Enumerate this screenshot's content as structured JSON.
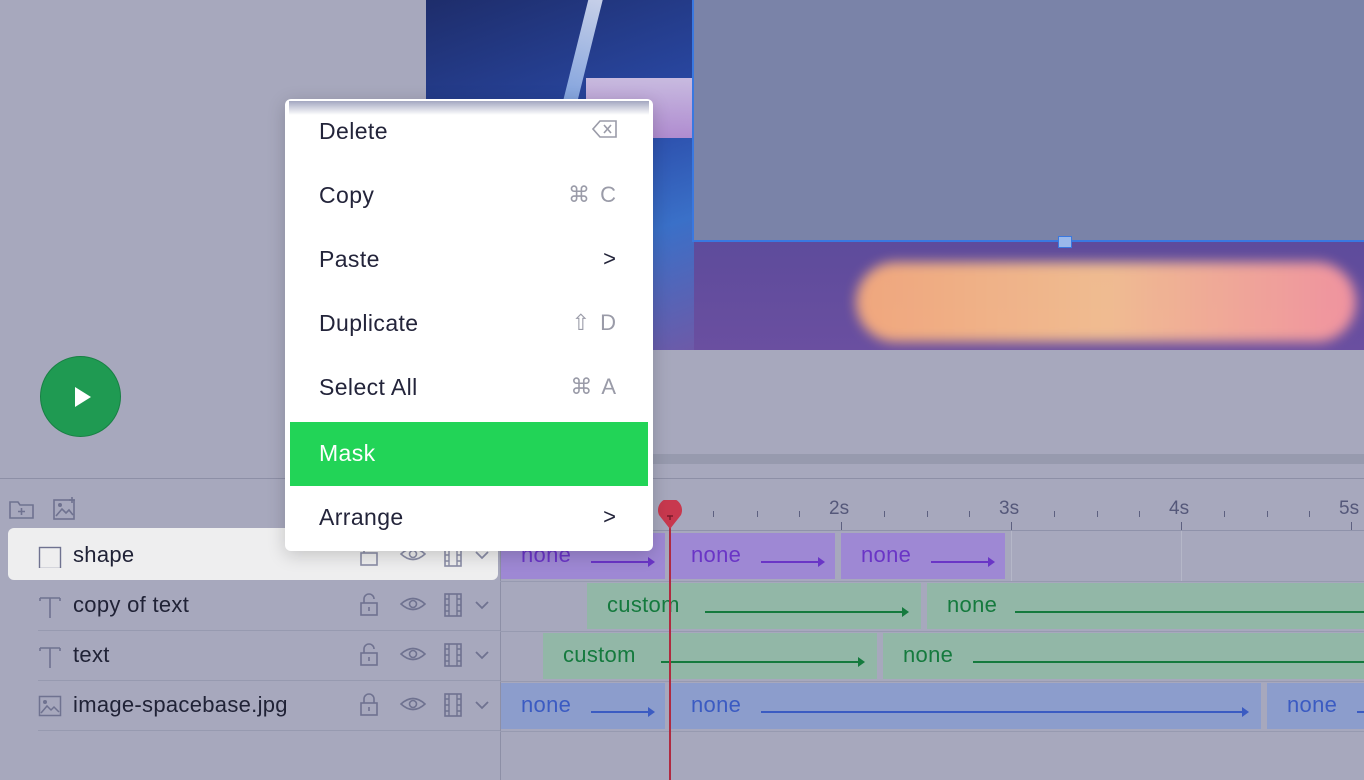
{
  "playback": {
    "play_icon": "play-icon"
  },
  "context_menu": {
    "items": [
      {
        "label": "Delete",
        "shortcut": "⌫"
      },
      {
        "label": "Copy",
        "shortcut": "⌘ C"
      },
      {
        "label": "Paste",
        "shortcut": ">"
      },
      {
        "label": "Duplicate",
        "shortcut": "⇧ D"
      },
      {
        "label": "Select All",
        "shortcut": "⌘ A"
      },
      {
        "label": "Mask",
        "shortcut": ""
      },
      {
        "label": "Arrange",
        "shortcut": ">"
      }
    ],
    "highlight_color": "#22d457"
  },
  "timeline": {
    "ruler_labels": [
      "2s",
      "3s",
      "4s",
      "5s"
    ],
    "playhead_color": "#b02a40",
    "layers": [
      {
        "name": "shape",
        "type_icon": "rectangle-icon",
        "selected": true
      },
      {
        "name": "copy of text",
        "type_icon": "text-icon",
        "selected": false
      },
      {
        "name": "text",
        "type_icon": "text-icon",
        "selected": false
      },
      {
        "name": "image-spacebase.jpg",
        "type_icon": "image-icon",
        "selected": false
      }
    ],
    "tracks": {
      "shape": [
        "none",
        "none",
        "none"
      ],
      "copy_of_text": [
        "custom",
        "none"
      ],
      "text": [
        "custom",
        "none"
      ],
      "image": [
        "none",
        "none",
        "none"
      ]
    }
  },
  "colors": {
    "shape_clip": "#9e88d4",
    "text_clip": "#92b7a7",
    "image_clip": "#8c9dcc",
    "play_button": "#1f9a52"
  }
}
